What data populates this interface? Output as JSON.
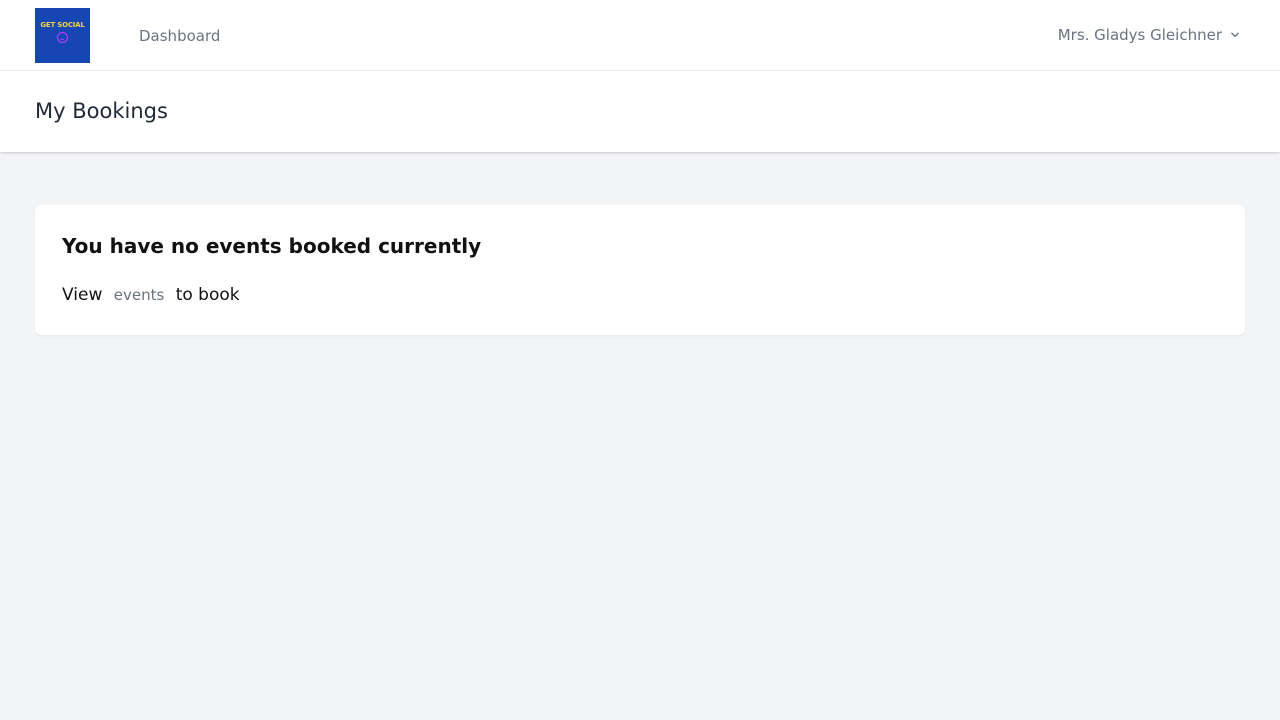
{
  "nav": {
    "logo_text": "GET SOCIAL",
    "dashboard_label": "Dashboard",
    "user_name": "Mrs. Gladys Gleichner",
    "user_menu_icon": "chevron-down-icon"
  },
  "header": {
    "title": "My Bookings"
  },
  "card": {
    "heading": "You have no events booked currently",
    "prefix": "View",
    "link_label": "events",
    "suffix": "to book"
  },
  "colors": {
    "logo_background": "#1646b4",
    "logo_text": "#f4d33c",
    "logo_smiley": "#c83cff",
    "page_background": "#f3f4f6",
    "muted_text": "#6b7280"
  }
}
